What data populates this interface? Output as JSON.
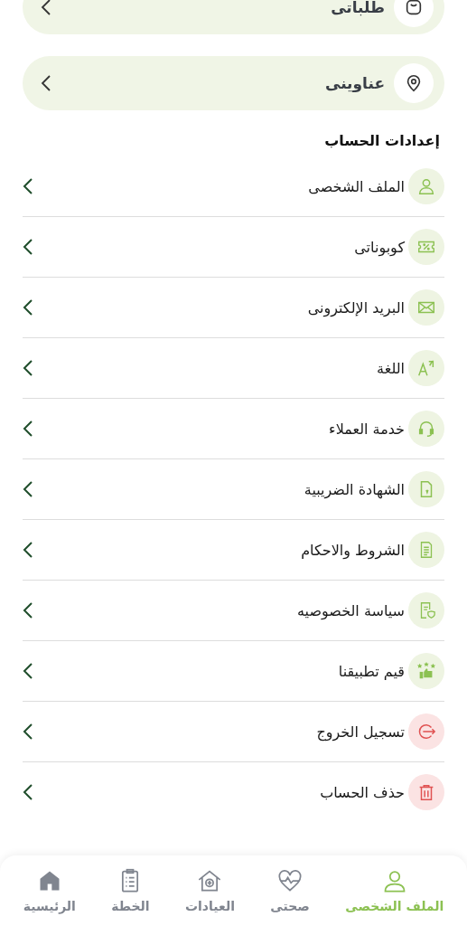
{
  "cards": [
    {
      "label": "طلباتى"
    },
    {
      "label": "عناوينى"
    }
  ],
  "section_title": "إعدادات الحساب",
  "settings": [
    {
      "label": "الملف الشخصى",
      "kind": "normal"
    },
    {
      "label": "كوبوناتى",
      "kind": "normal"
    },
    {
      "label": "البريد الإلكترونى",
      "kind": "normal"
    },
    {
      "label": "اللغة",
      "kind": "normal"
    },
    {
      "label": "خدمة العملاء",
      "kind": "normal"
    },
    {
      "label": "الشهادة الضريبية",
      "kind": "normal"
    },
    {
      "label": "الشروط والاحكام",
      "kind": "normal"
    },
    {
      "label": "سياسة الخصوصيه",
      "kind": "normal"
    },
    {
      "label": "قيم تطبيقنا",
      "kind": "normal"
    },
    {
      "label": "تسجيل الخروج",
      "kind": "danger"
    },
    {
      "label": "حذف الحساب",
      "kind": "danger"
    }
  ],
  "bottom_nav": [
    {
      "label": "الملف الشخصى",
      "selected": true
    },
    {
      "label": "صحتى",
      "selected": false
    },
    {
      "label": "العيادات",
      "selected": false
    },
    {
      "label": "الخطة",
      "selected": false
    },
    {
      "label": "الرئيسية",
      "selected": false
    }
  ]
}
